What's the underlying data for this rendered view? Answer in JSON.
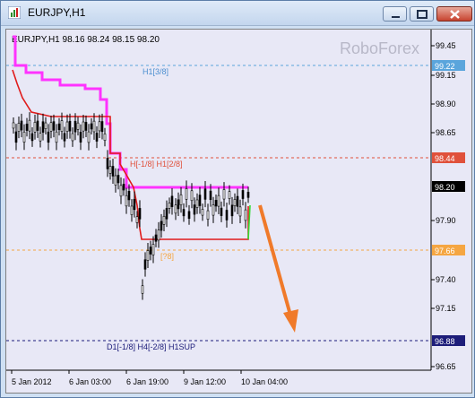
{
  "window": {
    "title": "EURJPY,H1",
    "buttons": {
      "minimize": "minimize",
      "maximize": "maximize",
      "close": "close"
    }
  },
  "chart": {
    "header": "EURJPY,H1  98.16 98.24 98.15 98.20",
    "watermark": "RoboForex",
    "y_ticks": [
      "99.45",
      "99.15",
      "98.90",
      "98.65",
      "98.20",
      "97.90",
      "97.66",
      "97.40",
      "97.15",
      "96.65"
    ],
    "x_ticks": [
      "5 Jan 2012",
      "6 Jan 03:00",
      "6 Jan 19:00",
      "9 Jan 12:00",
      "10 Jan 04:00"
    ],
    "price_badges": [
      {
        "label": "99.22",
        "color": "#5aa5dc"
      },
      {
        "label": "98.44",
        "color": "#e0513b"
      },
      {
        "label": "98.20",
        "color": "#000000"
      },
      {
        "label": "97.66",
        "color": "#f5a642"
      },
      {
        "label": "96.88",
        "color": "#1d1d7a"
      }
    ],
    "level_labels": [
      {
        "text": "H1[3/8]",
        "color": "#4c8fd0"
      },
      {
        "text": "H[-1/8] H1[2/8]",
        "color": "#e0513b"
      },
      {
        "text": "[?8]",
        "color": "#f5a642"
      },
      {
        "text": "D1[-1/8] H4[-2/8] H1SUP",
        "color": "#1d1d7a"
      }
    ],
    "colors": {
      "upper_line": "#ff33ff",
      "lower_line": "#e01b1b",
      "green_line": "#33dd33",
      "arrow": "#f07a2a"
    }
  }
}
